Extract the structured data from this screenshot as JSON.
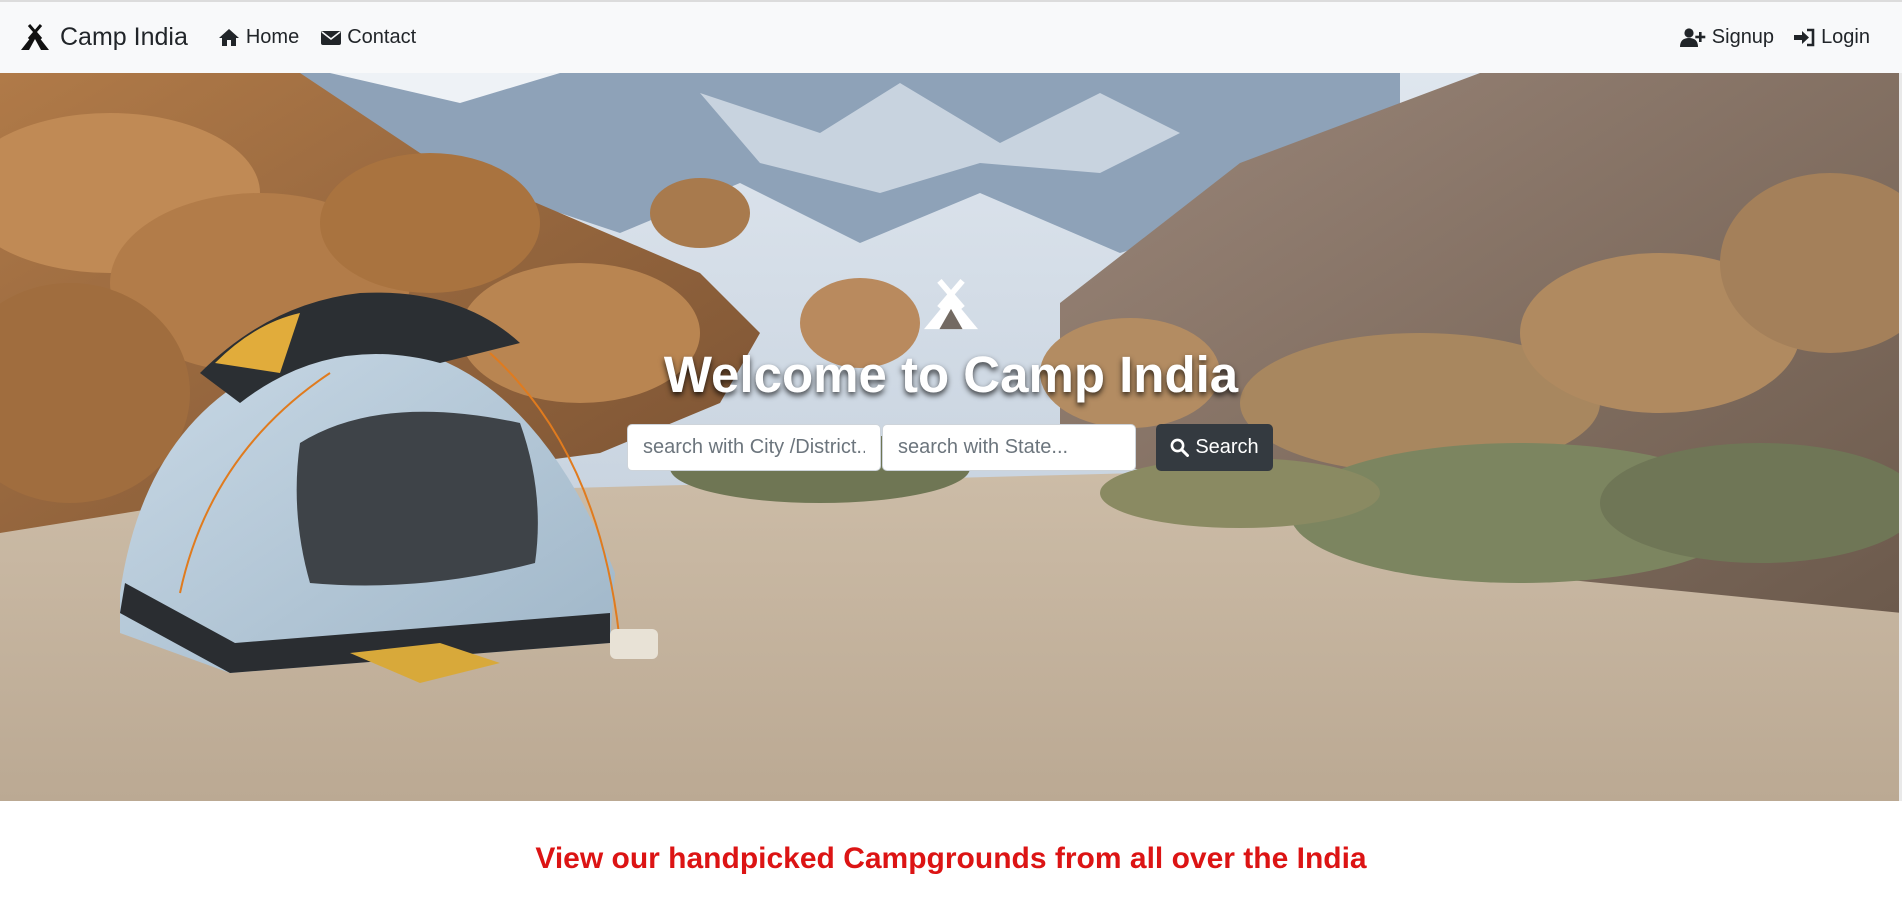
{
  "navbar": {
    "brand": "Camp India",
    "brand_icon": "campground-icon",
    "links_left": [
      {
        "label": "Home",
        "icon": "home-icon"
      },
      {
        "label": "Contact",
        "icon": "envelope-icon"
      }
    ],
    "links_right": [
      {
        "label": "Signup",
        "icon": "user-plus-icon"
      },
      {
        "label": "Login",
        "icon": "sign-in-icon"
      }
    ]
  },
  "hero": {
    "icon": "campground-icon",
    "title": "Welcome to Camp India",
    "city_placeholder": "search with City /District..",
    "state_placeholder": "search with State...",
    "search_label": "Search",
    "search_icon": "search-icon"
  },
  "section": {
    "heading": "View our handpicked Campgrounds from all over the India"
  },
  "colors": {
    "navbar_bg": "#f8f9fa",
    "button_dark": "#343a40",
    "heading_red": "#dc1414"
  }
}
